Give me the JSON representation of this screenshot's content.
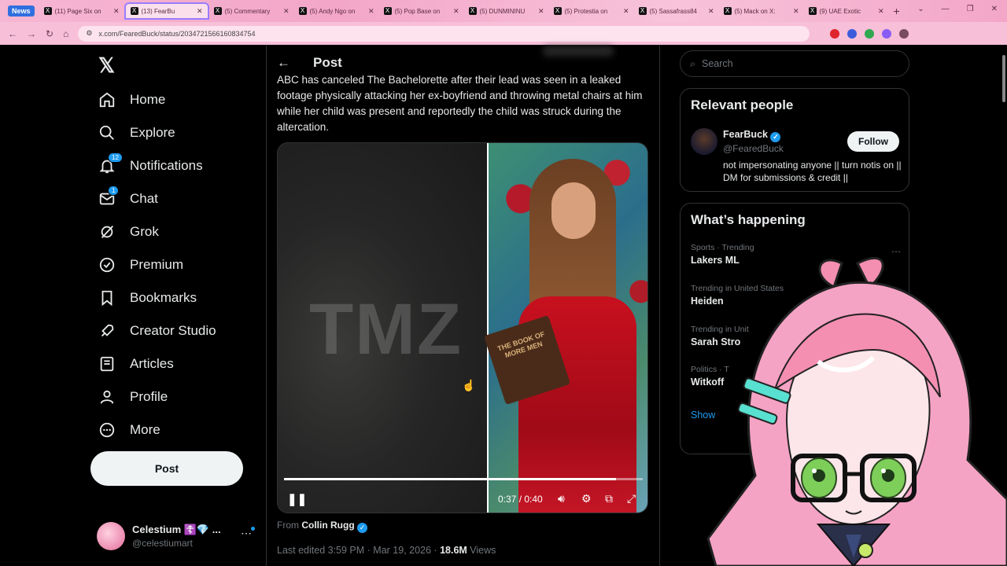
{
  "browser": {
    "news_chip": "News",
    "tabs": [
      {
        "label": "(11) Page Six on",
        "active": false
      },
      {
        "label": "(13) FearBu",
        "active": true
      },
      {
        "label": "(5) Commentary",
        "active": false
      },
      {
        "label": "(5) Andy Ngo on",
        "active": false
      },
      {
        "label": "(5) Pop Base on",
        "active": false
      },
      {
        "label": "(5) DUNMININU",
        "active": false
      },
      {
        "label": "(5) Protestia on",
        "active": false
      },
      {
        "label": "(5) Sassafrass84",
        "active": false
      },
      {
        "label": "(5) Mack on X:",
        "active": false
      },
      {
        "label": "(9) UAE Exotic",
        "active": false
      }
    ],
    "new_tab": "+",
    "url": "x.com/FearedBuck/status/2034721566160834754"
  },
  "nav": {
    "items": [
      {
        "label": "Home",
        "icon": "home-icon"
      },
      {
        "label": "Explore",
        "icon": "search-icon"
      },
      {
        "label": "Notifications",
        "icon": "bell-icon",
        "badge": "12"
      },
      {
        "label": "Chat",
        "icon": "mail-icon",
        "badge": "1"
      },
      {
        "label": "Grok",
        "icon": "grok-icon"
      },
      {
        "label": "Premium",
        "icon": "premium-icon"
      },
      {
        "label": "Bookmarks",
        "icon": "bookmark-icon"
      },
      {
        "label": "Creator Studio",
        "icon": "rocket-icon"
      },
      {
        "label": "Articles",
        "icon": "article-icon"
      },
      {
        "label": "Profile",
        "icon": "person-icon"
      },
      {
        "label": "More",
        "icon": "more-icon"
      }
    ],
    "post_button": "Post",
    "account": {
      "name": "Celestium ☦️💎 ...",
      "handle": "@celestiumart"
    }
  },
  "post": {
    "header": "Post",
    "text": "ABC has canceled The Bachelorette after their lead was seen in a leaked footage physically attacking her ex-boyfriend and throwing metal chairs at him while her child was present and reportedly the child was struck during the altercation.",
    "video": {
      "watermark": "TMZ",
      "book_text": "THE BOOK OF MORE MEN",
      "time": "0:37 / 0:40",
      "progress": 0.925
    },
    "from_prefix": "From",
    "from_name": "Collin Rugg",
    "meta": "Last edited 3:59 PM · Mar 19, 2026 · ",
    "views": "18.6M",
    "views_label": " Views"
  },
  "right": {
    "search_placeholder": "Search",
    "relevant": {
      "title": "Relevant people",
      "name": "FearBuck",
      "handle": "@FearedBuck",
      "follow": "Follow",
      "bio": "not impersonating anyone || turn notis on || DM for submissions & credit ||"
    },
    "happening": {
      "title": "What’s happening",
      "trends": [
        {
          "context": "Sports · Trending",
          "name": "Lakers ML"
        },
        {
          "context": "Trending in United States",
          "name": "Heiden"
        },
        {
          "context": "Trending in Unit",
          "name": "Sarah Stro"
        },
        {
          "context": "Politics · T",
          "name": "Witkoff"
        }
      ],
      "show_more": "Show"
    }
  },
  "colors": {
    "accent": "#1d9bf0",
    "background": "#000000",
    "browser_pink": "#f3a6c8"
  }
}
